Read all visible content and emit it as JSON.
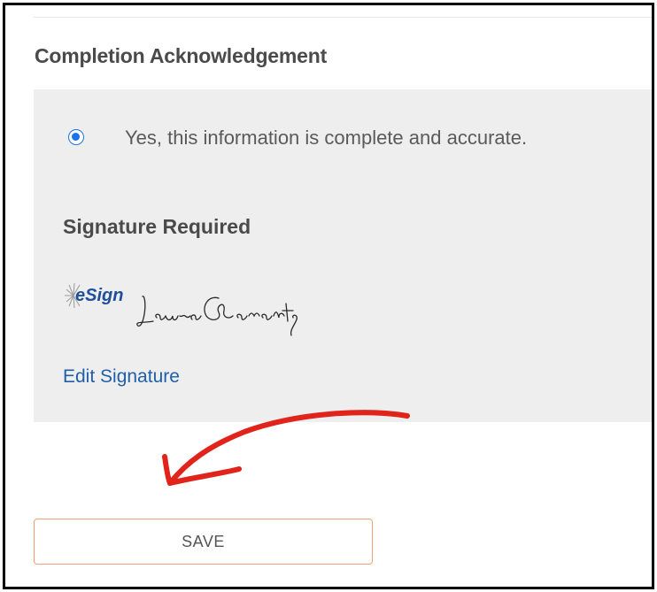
{
  "section": {
    "title": "Completion Acknowledgement"
  },
  "acknowledgement": {
    "option_label": "Yes, this information is complete and accurate.",
    "selected": true
  },
  "signature": {
    "heading": "Signature Required",
    "logo_text": "eSign",
    "signed_name": "Laura Barrantes",
    "edit_label": "Edit Signature"
  },
  "footer": {
    "save_label": "SAVE"
  },
  "colors": {
    "accent": "#1a73e8",
    "link": "#1f5fa8",
    "panel_bg": "#eeeeee",
    "arrow": "#e0241b",
    "button_border": "#f0a070"
  }
}
